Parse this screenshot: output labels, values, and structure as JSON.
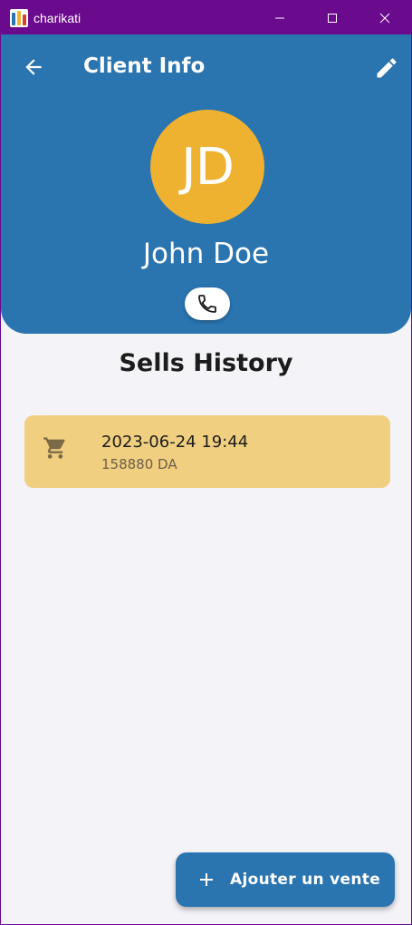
{
  "window": {
    "title": "charikati",
    "controls": [
      "minimize-icon",
      "maximize-icon",
      "close-icon"
    ]
  },
  "header": {
    "title": "Client Info",
    "back_icon": "arrow-left-icon",
    "edit_icon": "pencil-icon"
  },
  "client": {
    "initials": "JD",
    "name": "John Doe",
    "call_icon": "phone-icon"
  },
  "history": {
    "title": "Sells History",
    "sales": [
      {
        "date": "2023-06-24 19:44",
        "amount": "158880 DA",
        "icon": "cart-icon"
      }
    ]
  },
  "fab": {
    "label": "Ajouter un vente",
    "icon": "plus-icon"
  },
  "colors": {
    "titlebar": "#6a0a8c",
    "primary": "#2a74b0",
    "avatar": "#eeb130",
    "card": "#f0cf80",
    "background": "#f4f3f8"
  }
}
